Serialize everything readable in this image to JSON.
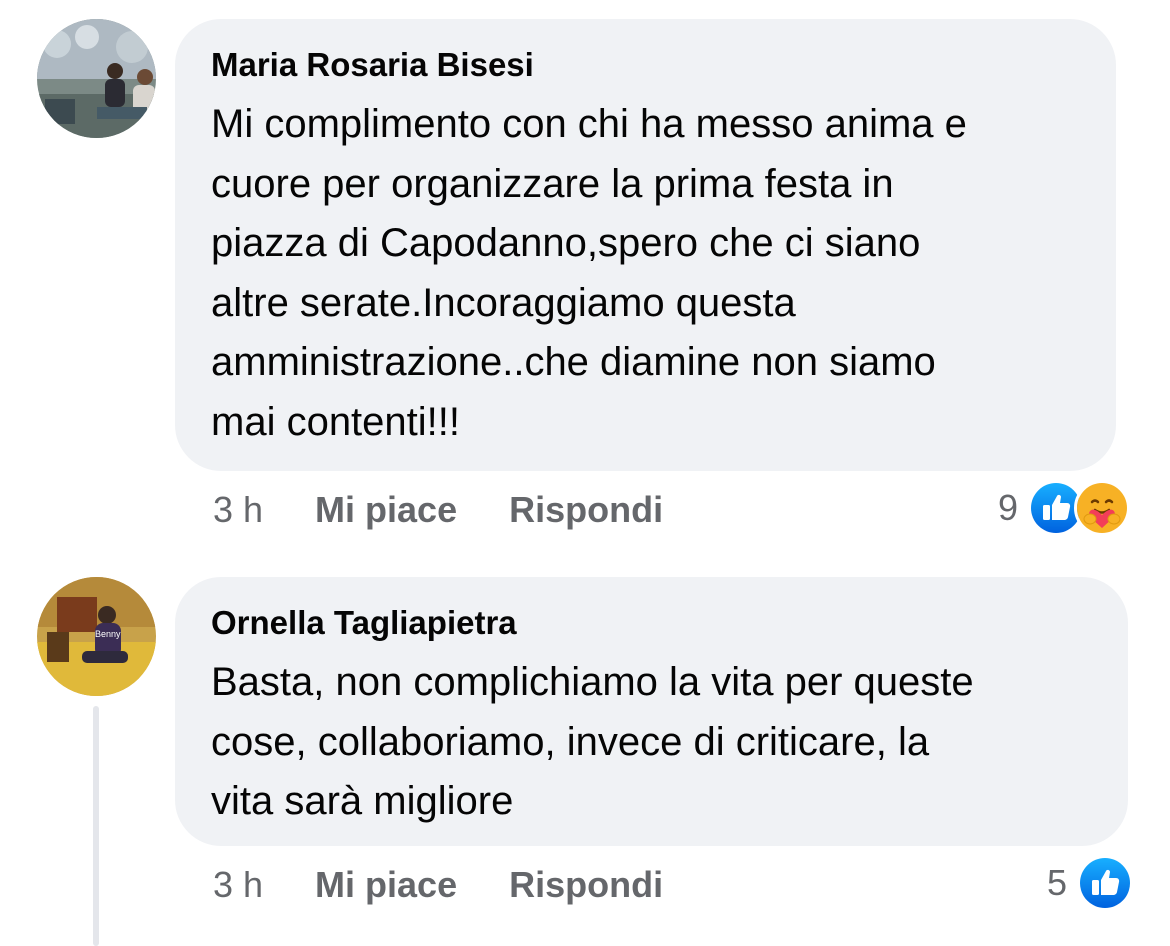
{
  "comments": [
    {
      "author": "Maria Rosaria Bisesi",
      "text_lines": [
        "Mi complimento con chi ha messo anima e",
        "cuore per organizzare la prima festa in",
        "piazza di Capodanno,spero che ci siano",
        "altre serate.Incoraggiamo questa",
        "amministrazione..che diamine non siamo",
        "mai contenti!!!"
      ],
      "time": "3 h",
      "like_label": "Mi piace",
      "reply_label": "Rispondi",
      "reaction_count": "9",
      "reactions": [
        "like-reaction-icon",
        "care-reaction-icon"
      ]
    },
    {
      "author": "Ornella Tagliapietra",
      "avatar_caption": "Benny",
      "text_lines": [
        "Basta, non complichiamo la vita per queste",
        "cose, collaboriamo, invece di criticare, la",
        "vita sarà migliore"
      ],
      "time": "3 h",
      "like_label": "Mi piace",
      "reply_label": "Rispondi",
      "reaction_count": "5",
      "reactions": [
        "like-reaction-icon"
      ]
    }
  ],
  "colors": {
    "bubble": "#f0f2f5",
    "meta_text": "#65676b",
    "like_blue": "#1877f2",
    "care_yellow": "#f7b125",
    "care_heart": "#f33e58"
  }
}
